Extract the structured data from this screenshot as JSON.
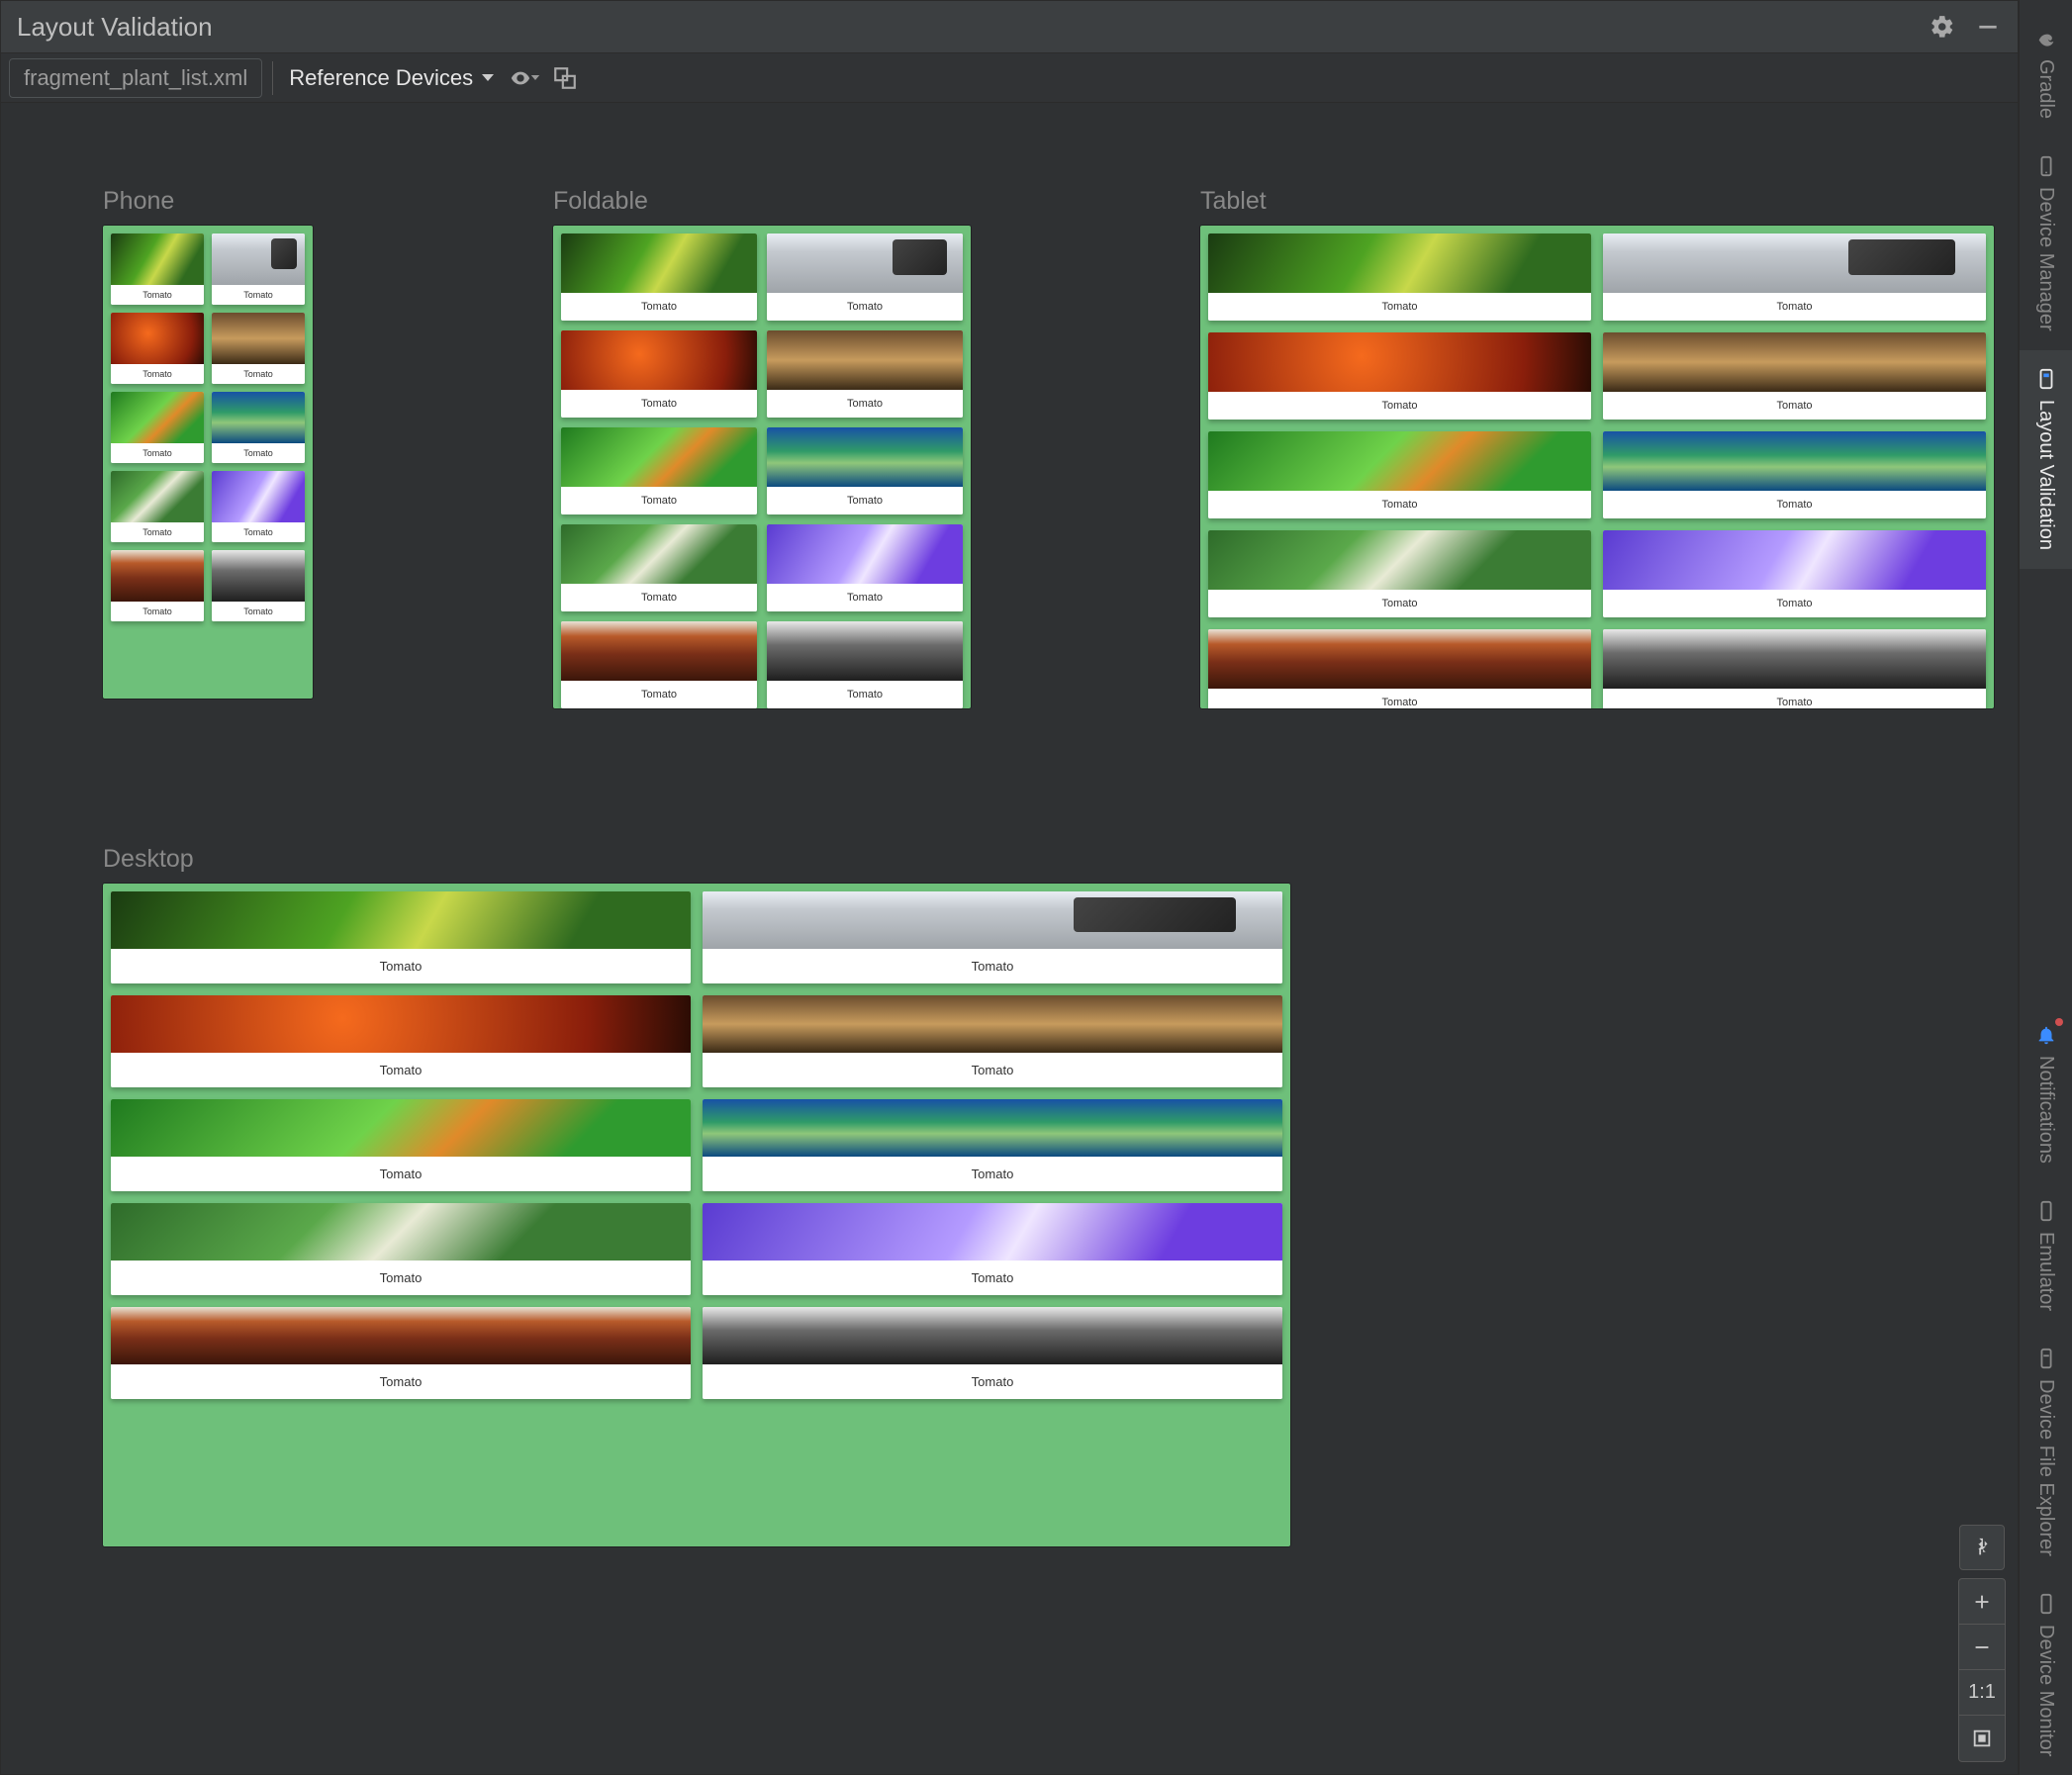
{
  "header": {
    "title": "Layout Validation"
  },
  "toolbar": {
    "file": "fragment_plant_list.xml",
    "dropdown_label": "Reference Devices"
  },
  "card_label": "Tomato",
  "devices": [
    {
      "key": "phone",
      "label": "Phone",
      "card_count": 10
    },
    {
      "key": "foldable",
      "label": "Foldable",
      "card_count": 10
    },
    {
      "key": "tablet",
      "label": "Tablet",
      "card_count": 10
    },
    {
      "key": "desktop",
      "label": "Desktop",
      "card_count": 10
    }
  ],
  "right_rail": [
    {
      "key": "gradle",
      "label": "Gradle"
    },
    {
      "key": "device-manager",
      "label": "Device Manager"
    },
    {
      "key": "layout-validation",
      "label": "Layout Validation",
      "active": true
    },
    {
      "key": "notifications",
      "label": "Notifications",
      "notify": true
    },
    {
      "key": "emulator",
      "label": "Emulator"
    },
    {
      "key": "device-file-explorer",
      "label": "Device File Explorer"
    },
    {
      "key": "device-monitor",
      "label": "Device Monitor"
    }
  ],
  "zoom": {
    "one_to_one": "1:1"
  }
}
